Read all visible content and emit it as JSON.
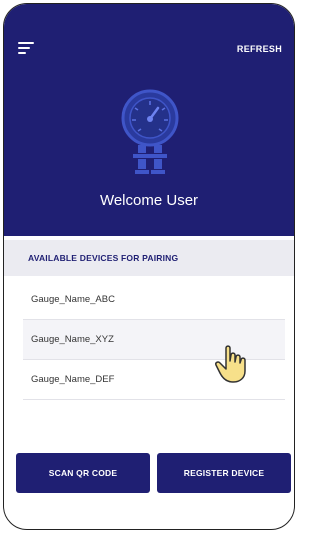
{
  "header": {
    "refresh_label": "REFRESH",
    "welcome_text": "Welcome User",
    "background_color": "#1f1f73",
    "menu_icon": "hamburger-menu-icon",
    "logo_icon": "pressure-gauge-icon"
  },
  "devices": {
    "section_title": "AVAILABLE DEVICES FOR PAIRING",
    "items": [
      {
        "label": "Gauge_Name_ABC"
      },
      {
        "label": "Gauge_Name_XYZ",
        "selected": true
      },
      {
        "label": "Gauge_Name_DEF"
      }
    ]
  },
  "actions": {
    "scan_label": "SCAN QR CODE",
    "register_label": "REGISTER DEVICE"
  },
  "cursor_icon": "hand-pointer-icon"
}
